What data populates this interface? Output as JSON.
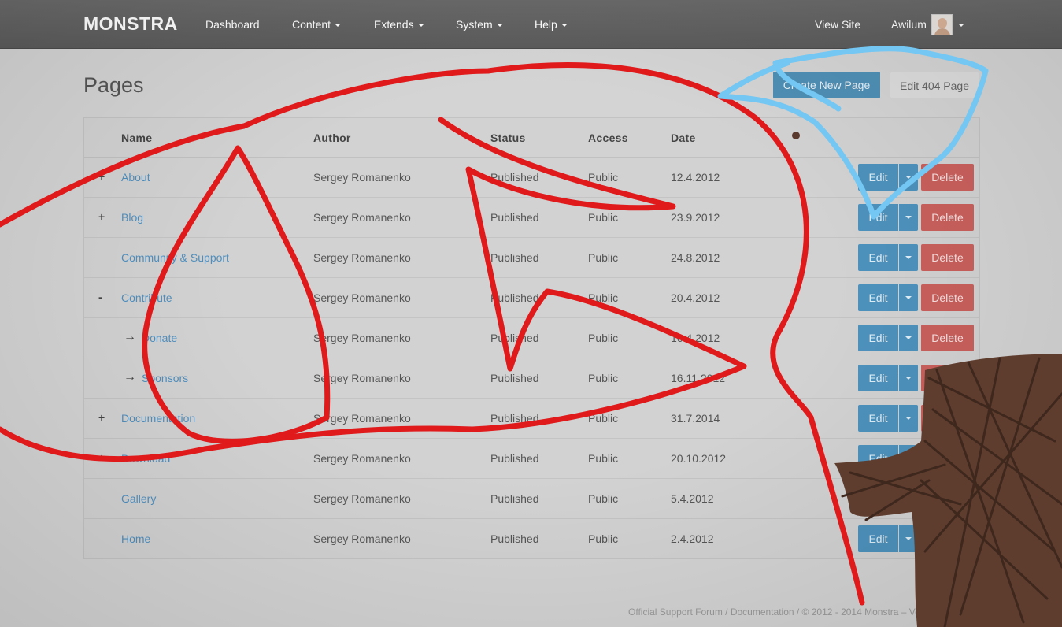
{
  "navbar": {
    "brand": "MONSTRA",
    "items": [
      {
        "label": "Dashboard",
        "dropdown": false
      },
      {
        "label": "Content",
        "dropdown": true
      },
      {
        "label": "Extends",
        "dropdown": true
      },
      {
        "label": "System",
        "dropdown": true
      },
      {
        "label": "Help",
        "dropdown": true
      }
    ],
    "view_site": "View Site",
    "user": "Awilum"
  },
  "header": {
    "title": "Pages",
    "create_label": "Create New Page",
    "edit404_label": "Edit 404 Page"
  },
  "table": {
    "columns": [
      "Name",
      "Author",
      "Status",
      "Access",
      "Date"
    ],
    "edit_label": "Edit",
    "delete_label": "Delete",
    "rows": [
      {
        "toggle": "+",
        "child": false,
        "name": "About",
        "author": "Sergey Romanenko",
        "status": "Published",
        "access": "Public",
        "date": "12.4.2012"
      },
      {
        "toggle": "+",
        "child": false,
        "name": "Blog",
        "author": "Sergey Romanenko",
        "status": "Published",
        "access": "Public",
        "date": "23.9.2012"
      },
      {
        "toggle": "",
        "child": false,
        "name": "Community & Support",
        "author": "Sergey Romanenko",
        "status": "Published",
        "access": "Public",
        "date": "24.8.2012"
      },
      {
        "toggle": "-",
        "child": false,
        "name": "Contribute",
        "author": "Sergey Romanenko",
        "status": "Published",
        "access": "Public",
        "date": "20.4.2012"
      },
      {
        "toggle": "",
        "child": true,
        "name": "Donate",
        "author": "Sergey Romanenko",
        "status": "Published",
        "access": "Public",
        "date": "16.4.2012"
      },
      {
        "toggle": "",
        "child": true,
        "name": "Sponsors",
        "author": "Sergey Romanenko",
        "status": "Published",
        "access": "Public",
        "date": "16.11.2012"
      },
      {
        "toggle": "+",
        "child": false,
        "name": "Documentation",
        "author": "Sergey Romanenko",
        "status": "Published",
        "access": "Public",
        "date": "31.7.2014"
      },
      {
        "toggle": "+",
        "child": false,
        "name": "Download",
        "author": "Sergey Romanenko",
        "status": "Published",
        "access": "Public",
        "date": "20.10.2012"
      },
      {
        "toggle": "",
        "child": false,
        "name": "Gallery",
        "author": "Sergey Romanenko",
        "status": "Published",
        "access": "Public",
        "date": "5.4.2012"
      },
      {
        "toggle": "",
        "child": false,
        "name": "Home",
        "author": "Sergey Romanenko",
        "status": "Published",
        "access": "Public",
        "date": "2.4.2012"
      }
    ]
  },
  "footer": {
    "text": "Official Support Forum / Documentation / © 2012 - 2014 Monstra – Version 3"
  },
  "colors": {
    "accent": "#4d92bd",
    "danger": "#c9605d",
    "link": "#4f8fbf",
    "scribble_red": "#e0191b",
    "scribble_blue": "#73c7f2",
    "scribble_brown": "#5a3a2c"
  }
}
